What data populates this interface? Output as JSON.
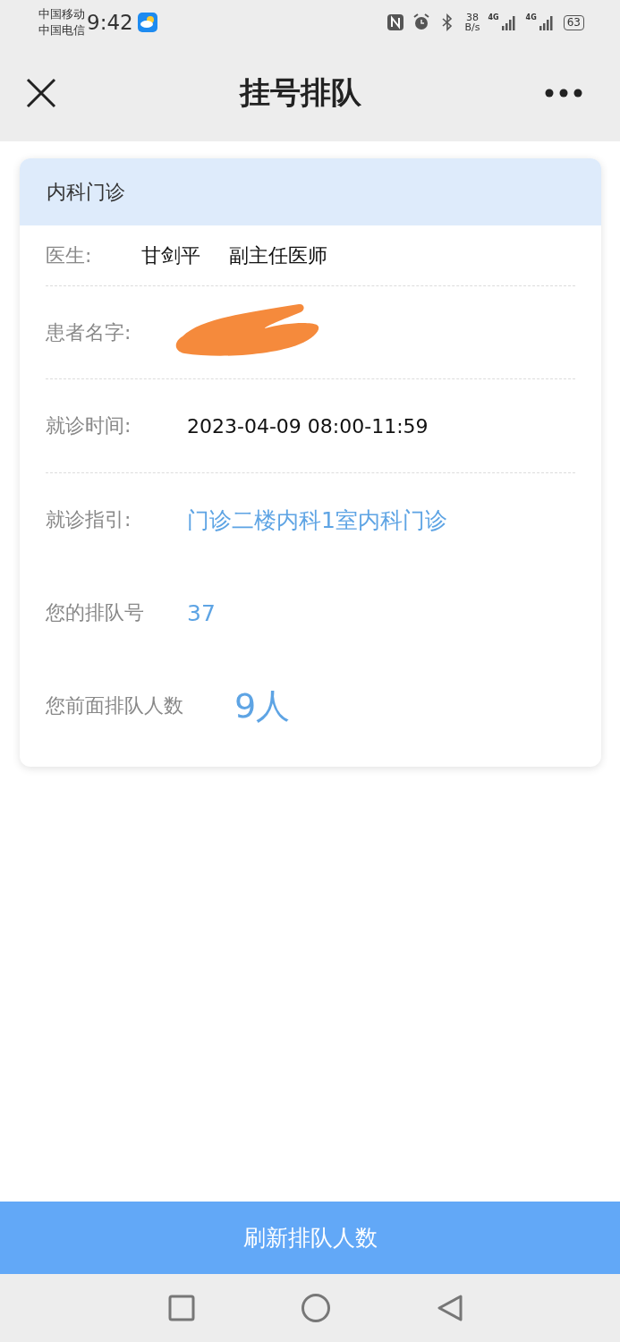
{
  "status_bar": {
    "carriers": [
      "中国移动",
      "中国电信"
    ],
    "time": "9:42",
    "net_speed": [
      "38",
      "B/s"
    ],
    "signals": [
      "4G",
      "4G"
    ],
    "battery": "63"
  },
  "header": {
    "title": "挂号排队"
  },
  "card": {
    "title": "内科门诊",
    "rows": [
      {
        "label": "医生:",
        "kind": "plain",
        "values": [
          "甘剑平",
          "副主任医师"
        ],
        "divider": true
      },
      {
        "label": "患者名字:",
        "kind": "redacted",
        "divider": true
      },
      {
        "label": "就诊时间:",
        "kind": "plain",
        "values": [
          "2023-04-09 08:00-11:59"
        ],
        "divider": true
      },
      {
        "label": "就诊指引:",
        "kind": "link",
        "values": [
          "门诊二楼内科1室内科门诊"
        ],
        "divider": false
      },
      {
        "label": "您的排队号",
        "kind": "number",
        "values": [
          "37"
        ],
        "divider": false
      },
      {
        "label": "您前面排队人数",
        "kind": "count",
        "values": [
          "9人"
        ],
        "divider": false
      }
    ]
  },
  "refresh_button": "刷新排队人数"
}
